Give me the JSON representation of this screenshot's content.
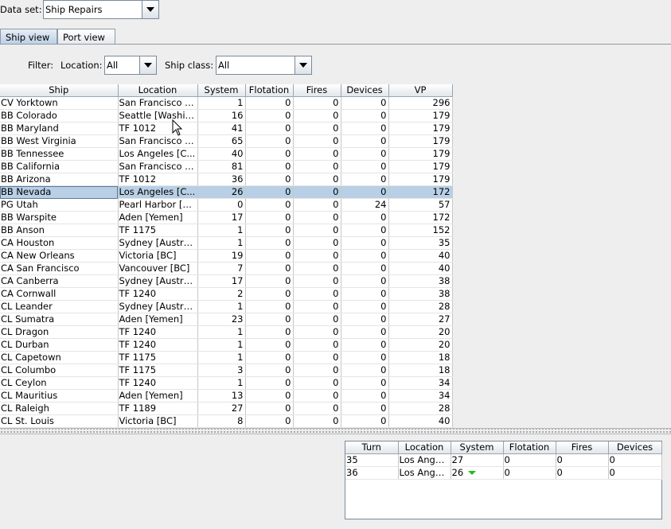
{
  "dataset": {
    "label": "Data set:",
    "value": "Ship Repairs"
  },
  "tabs": [
    {
      "label": "Ship view",
      "selected": true
    },
    {
      "label": "Port view",
      "selected": false
    }
  ],
  "filter": {
    "label": "Filter:",
    "location_label": "Location:",
    "location_value": "All",
    "shipclass_label": "Ship class:",
    "shipclass_value": "All"
  },
  "ships_table": {
    "columns": [
      "Ship",
      "Location",
      "System",
      "Flotation",
      "Fires",
      "Devices",
      "VP"
    ],
    "selected_row": 7,
    "rows": [
      [
        "CV Yorktown",
        "San Francisco [...",
        "1",
        "0",
        "0",
        "0",
        "296"
      ],
      [
        "BB Colorado",
        "Seattle [Washin...",
        "16",
        "0",
        "0",
        "0",
        "179"
      ],
      [
        "BB Maryland",
        "TF 1012",
        "41",
        "0",
        "0",
        "0",
        "179"
      ],
      [
        "BB West Virginia",
        "San Francisco [...",
        "65",
        "0",
        "0",
        "0",
        "179"
      ],
      [
        "BB Tennessee",
        "Los Angeles [C...",
        "40",
        "0",
        "0",
        "0",
        "179"
      ],
      [
        "BB California",
        "San Francisco [...",
        "81",
        "0",
        "0",
        "0",
        "179"
      ],
      [
        "BB Arizona",
        "TF 1012",
        "36",
        "0",
        "0",
        "0",
        "179"
      ],
      [
        "BB Nevada",
        "Los Angeles [C...",
        "26",
        "0",
        "0",
        "0",
        "172"
      ],
      [
        "PG Utah",
        "Pearl Harbor [O...",
        "0",
        "0",
        "0",
        "24",
        "57"
      ],
      [
        "BB Warspite",
        "Aden [Yemen]",
        "17",
        "0",
        "0",
        "0",
        "172"
      ],
      [
        "BB Anson",
        "TF 1175",
        "1",
        "0",
        "0",
        "0",
        "152"
      ],
      [
        "CA Houston",
        "Sydney [Australia]",
        "1",
        "0",
        "0",
        "0",
        "35"
      ],
      [
        "CA New Orleans",
        "Victoria [BC]",
        "19",
        "0",
        "0",
        "0",
        "40"
      ],
      [
        "CA San Francisco",
        "Vancouver [BC]",
        "7",
        "0",
        "0",
        "0",
        "40"
      ],
      [
        "CA Canberra",
        "Sydney [Australia]",
        "17",
        "0",
        "0",
        "0",
        "38"
      ],
      [
        "CA Cornwall",
        "TF 1240",
        "2",
        "0",
        "0",
        "0",
        "38"
      ],
      [
        "CL Leander",
        "Sydney [Australia]",
        "1",
        "0",
        "0",
        "0",
        "28"
      ],
      [
        "CL Sumatra",
        "Aden [Yemen]",
        "23",
        "0",
        "0",
        "0",
        "27"
      ],
      [
        "CL Dragon",
        "TF 1240",
        "1",
        "0",
        "0",
        "0",
        "20"
      ],
      [
        "CL Durban",
        "TF 1240",
        "1",
        "0",
        "0",
        "0",
        "20"
      ],
      [
        "CL Capetown",
        "TF 1175",
        "1",
        "0",
        "0",
        "0",
        "18"
      ],
      [
        "CL Columbo",
        "TF 1175",
        "3",
        "0",
        "0",
        "0",
        "18"
      ],
      [
        "CL Ceylon",
        "TF 1240",
        "1",
        "0",
        "0",
        "0",
        "34"
      ],
      [
        "CL Mauritius",
        "Aden [Yemen]",
        "13",
        "0",
        "0",
        "0",
        "34"
      ],
      [
        "CL Raleigh",
        "TF 1189",
        "27",
        "0",
        "0",
        "0",
        "28"
      ],
      [
        "CL St. Louis",
        "Victoria [BC]",
        "8",
        "0",
        "0",
        "0",
        "40"
      ]
    ]
  },
  "history_table": {
    "columns": [
      "Turn",
      "Location",
      "System",
      "Flotation",
      "Fires",
      "Devices"
    ],
    "rows": [
      [
        "35",
        "Los Ange...",
        "27",
        "0",
        "0",
        "0"
      ],
      [
        "36",
        "Los Ange...",
        "26",
        "0",
        "0",
        "0"
      ]
    ],
    "trend_row": 1,
    "trend_icon": "down-arrow-green",
    "trend_color": "#22bb22"
  }
}
